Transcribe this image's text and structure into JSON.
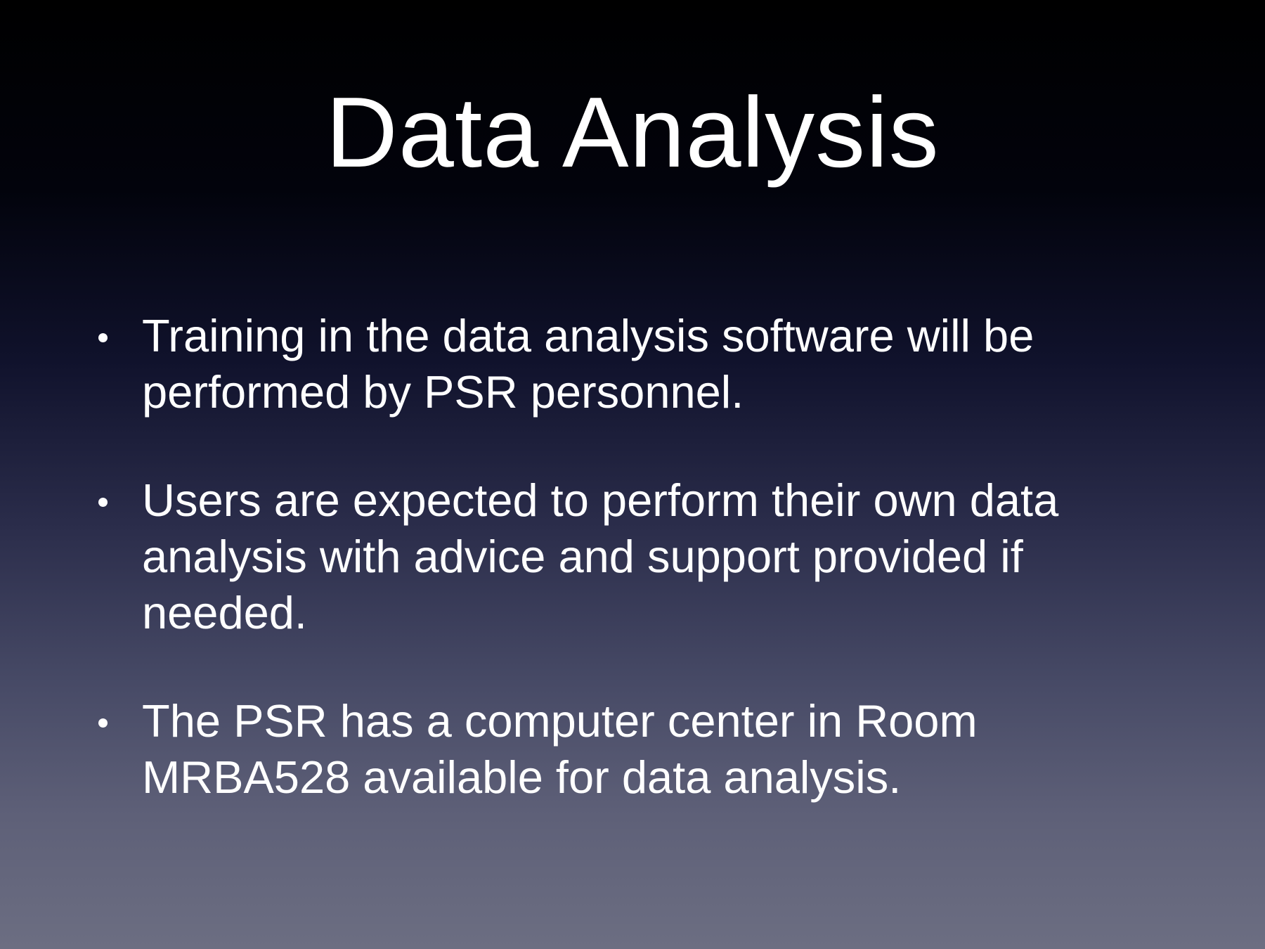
{
  "slide": {
    "title": "Data Analysis",
    "bullets": [
      {
        "lines": [
          "Training in the data analysis software will be",
          "performed by PSR personnel."
        ]
      },
      {
        "lines": [
          "Users are expected to perform their own data",
          "analysis with advice and support provided if",
          "needed."
        ]
      },
      {
        "lines": [
          "The PSR has a computer center in Room",
          "MRBA528 available for data analysis."
        ]
      }
    ]
  },
  "colors": {
    "text": "#ffffff",
    "background_top": "#000000",
    "background_bottom": "#6c6e82"
  }
}
